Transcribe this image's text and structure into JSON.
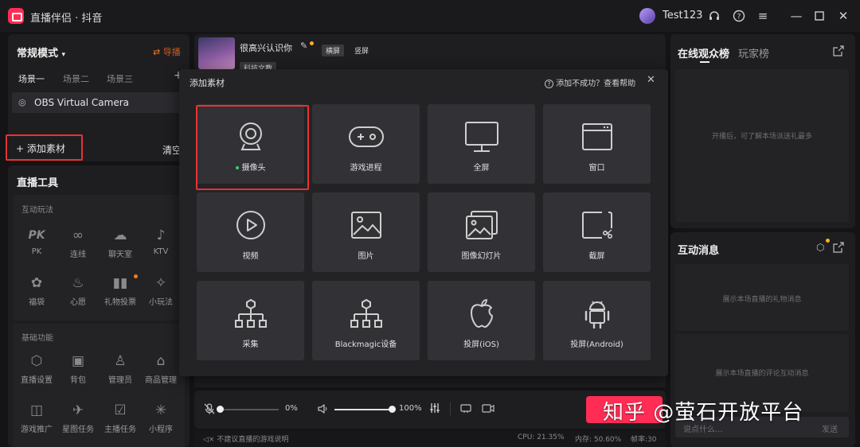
{
  "titlebar": {
    "app_title": "直播伴侣 · 抖音",
    "username": "Test123"
  },
  "left": {
    "mode_label": "常规模式",
    "switch_label": "导播",
    "scene_tabs": [
      "场景一",
      "场景二",
      "场景三"
    ],
    "source_item": "OBS Virtual Camera",
    "add_material": "添加素材",
    "clear_label": "清空",
    "tools_title": "直播工具",
    "interactive_section": "互动玩法",
    "interactive_items": [
      "PK",
      "连线",
      "聊天室",
      "KTV",
      "福袋",
      "心愿",
      "礼物投票",
      "小玩法"
    ],
    "basic_section": "基础功能",
    "basic_items": [
      "直播设置",
      "背包",
      "管理员",
      "商品管理",
      "游戏推广",
      "星图任务",
      "主播任务",
      "小程序"
    ]
  },
  "stream_header": {
    "title": "很高兴认识你",
    "tag_landscape": "横屏",
    "tag_portrait": "竖屏",
    "category": "科技文教"
  },
  "modal": {
    "title": "添加素材",
    "help_text": "添加不成功？查看帮助",
    "tiles": [
      {
        "label": "摄像头",
        "icon": "camera-icon"
      },
      {
        "label": "游戏进程",
        "icon": "gamepad-icon"
      },
      {
        "label": "全屏",
        "icon": "monitor-icon"
      },
      {
        "label": "窗口",
        "icon": "window-icon"
      },
      {
        "label": "视频",
        "icon": "play-icon"
      },
      {
        "label": "图片",
        "icon": "image-icon"
      },
      {
        "label": "图像幻灯片",
        "icon": "slideshow-icon"
      },
      {
        "label": "截屏",
        "icon": "screenshot-icon"
      },
      {
        "label": "采集",
        "icon": "capture-icon"
      },
      {
        "label": "Blackmagic设备",
        "icon": "blackmagic-icon"
      },
      {
        "label": "投屏(iOS)",
        "icon": "apple-icon"
      },
      {
        "label": "投屏(Android)",
        "icon": "android-icon"
      }
    ]
  },
  "audio_bar": {
    "mic_volume": "0%",
    "speaker_volume": "100%",
    "mic_level": 0,
    "speaker_level": 1
  },
  "status_bar": {
    "notice": "不建议直播的游戏说明",
    "cpu": "CPU: 21.35%",
    "memory": "内存: 50.60%",
    "fps": "帧率:30"
  },
  "right": {
    "tab_online": "在线观众榜",
    "tab_players": "玩家榜",
    "online_empty": "开播后，可了解本场派送礼最多",
    "messages_title": "互动消息",
    "gift_empty": "展示本场直播的礼物消息",
    "comment_empty": "展示本场直播的评论互动消息",
    "chat_placeholder": "说点什么...",
    "send_label": "发送"
  },
  "watermark": {
    "text": "知乎 @萤石开放平台"
  },
  "colors": {
    "accent_red": "#e83232",
    "brand_pink": "#ff2d55",
    "orange": "#ff7a1a"
  }
}
